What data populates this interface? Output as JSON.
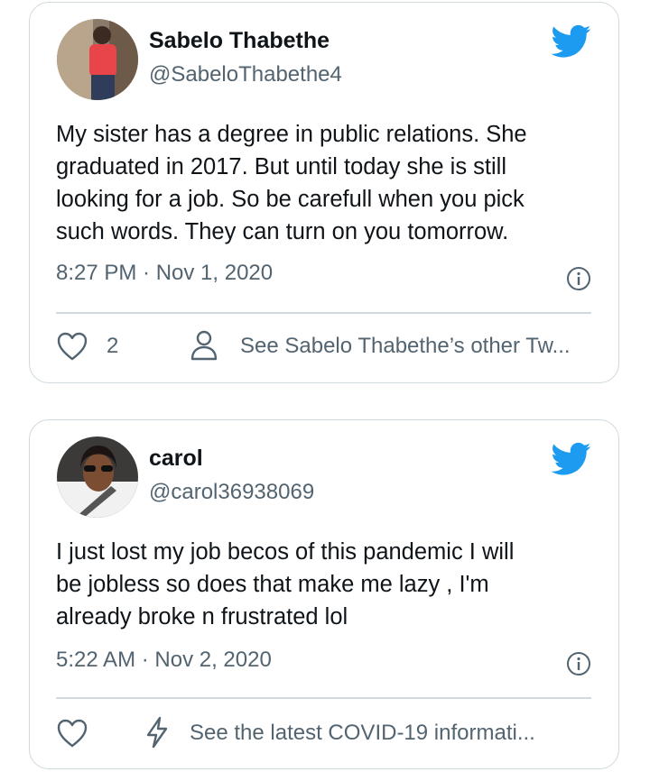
{
  "tweets": [
    {
      "name": "Sabelo Thabethe",
      "handle": "@SabeloThabethe4",
      "text": "My sister has a degree in public relations. She\ngraduated in 2017. But until today she is still\nlooking for a job. So be carefull when you pick\nsuch words.  They can turn on you tomorrow.",
      "timestamp": "8:27 PM · Nov 1, 2020",
      "like_count": "2",
      "action_text": "See Sabelo Thabethe’s other Tw...",
      "action_icon": "person-icon"
    },
    {
      "name": "carol",
      "handle": "@carol36938069",
      "text": "I just lost my job becos of  this pandemic I will\nbe jobless so does that make me lazy , I'm\nalready broke n frustrated lol",
      "timestamp": "5:22 AM · Nov 2, 2020",
      "like_count": "",
      "action_text": "See the latest COVID-19 informati...",
      "action_icon": "lightning-icon"
    }
  ],
  "colors": {
    "twitter_blue": "#1d9bf0",
    "secondary_text": "#536471",
    "border": "#cfd9de"
  }
}
